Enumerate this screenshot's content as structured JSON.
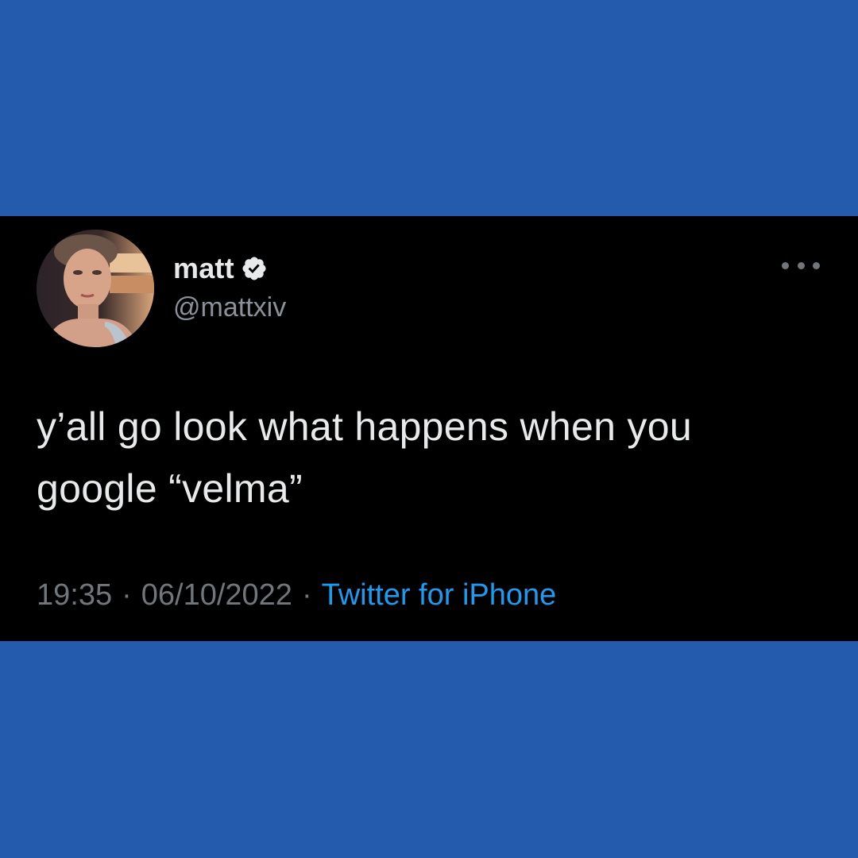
{
  "tweet": {
    "author": {
      "display_name": "matt",
      "handle": "@mattxiv",
      "verified": true
    },
    "text_line_1": "y’all go look what happens when you",
    "text_line_2": "google “velma”",
    "time": "19:35",
    "date": "06/10/2022",
    "separator": "·",
    "source": "Twitter for iPhone"
  },
  "colors": {
    "background": "#245bad",
    "card": "#000000",
    "link": "#1d9bf0",
    "muted": "#71767b",
    "text": "#e7e9ea"
  },
  "icons": [
    "avatar",
    "verified-badge-icon",
    "more-options-icon"
  ]
}
